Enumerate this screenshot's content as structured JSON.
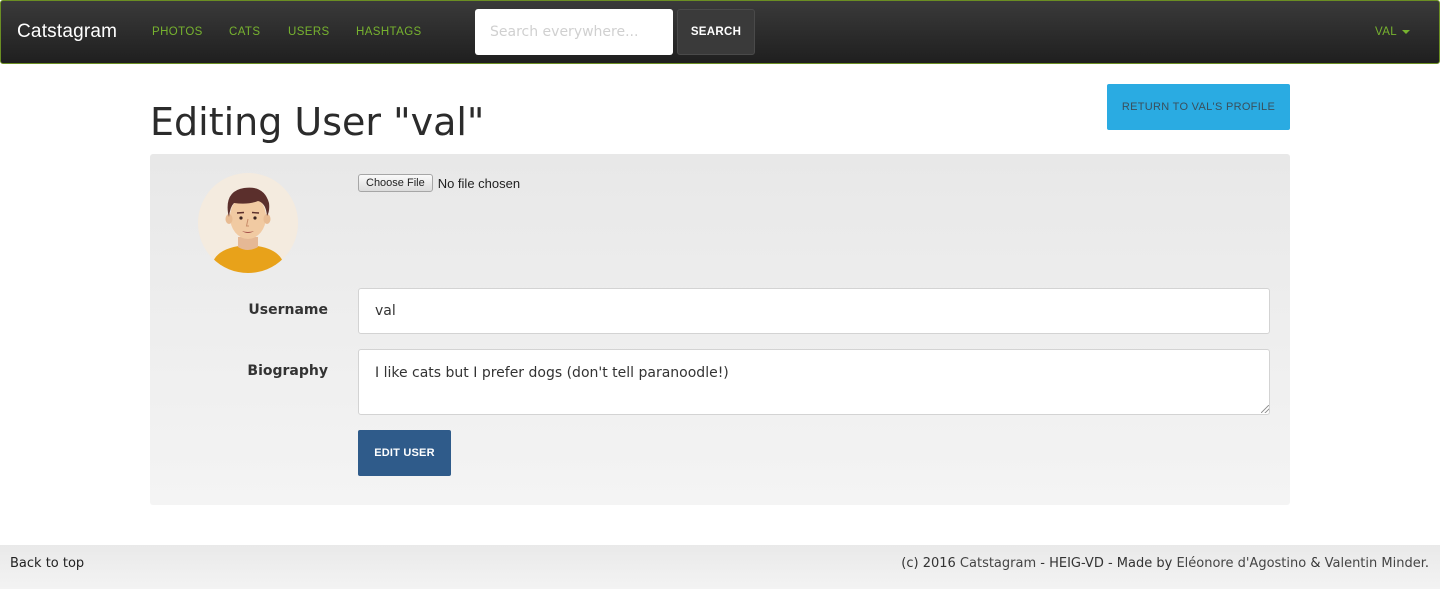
{
  "navbar": {
    "brand": "Catstagram",
    "links": [
      "PHOTOS",
      "CATS",
      "USERS",
      "HASHTAGS"
    ],
    "search_placeholder": "Search everywhere...",
    "search_label": "SEARCH",
    "user_label": "VAL"
  },
  "header": {
    "title": "Editing User \"val\"",
    "return_label": "RETURN TO VAL'S PROFILE"
  },
  "form": {
    "file_button": "Choose File",
    "file_status": "No file chosen",
    "username_label": "Username",
    "username_value": "val",
    "bio_label": "Biography",
    "bio_value": "I like cats but I prefer dogs (don't tell paranoodle!)",
    "submit_label": "EDIT USER"
  },
  "footer": {
    "back_to_top": "Back to top",
    "prefix": "(c) 2016 ",
    "site_link": "Catstagram",
    "middle": " - HEIG-VD - Made by ",
    "author1": "Eléonore d'Agostino",
    "amp": " & ",
    "author2": "Valentin Minder",
    "suffix": "."
  },
  "colors": {
    "nav_link": "#77b32f",
    "return_button": "#2aabe2",
    "submit_button": "#2f5b8a"
  }
}
